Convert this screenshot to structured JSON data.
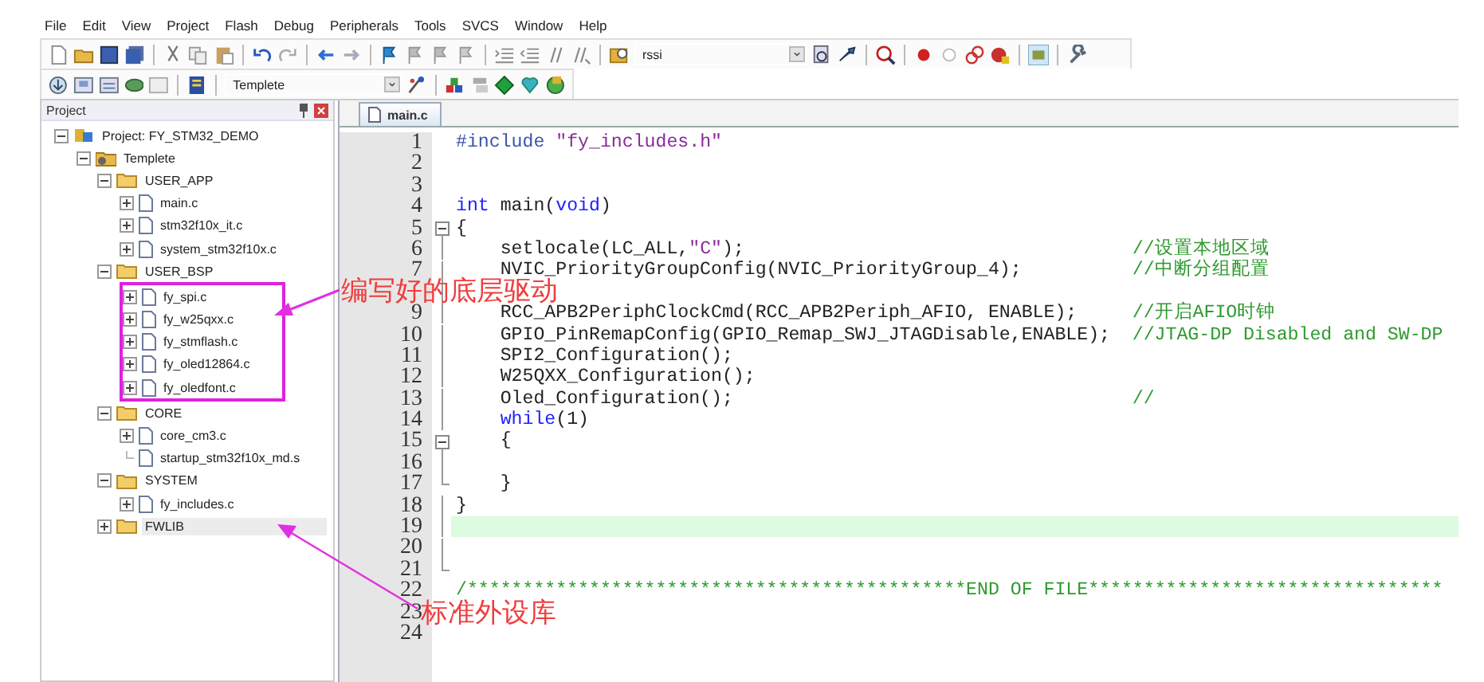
{
  "menu": [
    "File",
    "Edit",
    "View",
    "Project",
    "Flash",
    "Debug",
    "Peripherals",
    "Tools",
    "SVCS",
    "Window",
    "Help"
  ],
  "file_toolbar": {
    "find_text": "rssi"
  },
  "build_toolbar": {
    "target": "Templete"
  },
  "project_panel": {
    "title": "Project",
    "tree": [
      {
        "label": "Project: FY_STM32_DEMO",
        "kind": "project",
        "expanded": true,
        "selected": false,
        "children": [
          {
            "label": "Templete",
            "kind": "target",
            "expanded": true,
            "selected": false,
            "children": [
              {
                "label": "USER_APP",
                "kind": "group",
                "expanded": true,
                "selected": false,
                "children": [
                  {
                    "label": "main.c",
                    "kind": "file",
                    "expandable": true,
                    "selected": false
                  },
                  {
                    "label": "stm32f10x_it.c",
                    "kind": "file",
                    "expandable": true,
                    "selected": false
                  },
                  {
                    "label": "system_stm32f10x.c",
                    "kind": "file",
                    "expandable": true,
                    "selected": false
                  }
                ]
              },
              {
                "label": "USER_BSP",
                "kind": "group",
                "expanded": true,
                "selected": false,
                "boxed": true,
                "children": [
                  {
                    "label": "fy_spi.c",
                    "kind": "file",
                    "expandable": true,
                    "selected": false
                  },
                  {
                    "label": "fy_w25qxx.c",
                    "kind": "file",
                    "expandable": true,
                    "selected": false
                  },
                  {
                    "label": "fy_stmflash.c",
                    "kind": "file",
                    "expandable": true,
                    "selected": false
                  },
                  {
                    "label": "fy_oled12864.c",
                    "kind": "file",
                    "expandable": true,
                    "selected": false
                  },
                  {
                    "label": "fy_oledfont.c",
                    "kind": "file",
                    "expandable": true,
                    "selected": false
                  }
                ]
              },
              {
                "label": "CORE",
                "kind": "group",
                "expanded": true,
                "selected": false,
                "children": [
                  {
                    "label": "core_cm3.c",
                    "kind": "file",
                    "expandable": true,
                    "selected": false
                  },
                  {
                    "label": "startup_stm32f10x_md.s",
                    "kind": "file",
                    "expandable": false,
                    "selected": false
                  }
                ]
              },
              {
                "label": "SYSTEM",
                "kind": "group",
                "expanded": true,
                "selected": false,
                "children": [
                  {
                    "label": "fy_includes.c",
                    "kind": "file",
                    "expandable": true,
                    "selected": false
                  }
                ]
              },
              {
                "label": "FWLIB",
                "kind": "group",
                "expanded": false,
                "selected": true
              }
            ]
          }
        ]
      }
    ]
  },
  "editor": {
    "tabs": [
      {
        "label": "main.c",
        "selected": true
      }
    ],
    "lines": [
      {
        "number": "1",
        "kind": "plain",
        "code": [
          {
            "text": "#include",
            "kind": "preproc"
          },
          {
            "text": " \"fy_includes.h\"",
            "kind": "string"
          }
        ],
        "current": false
      },
      {
        "number": "2",
        "kind": "plain",
        "current": false
      },
      {
        "number": "3",
        "kind": "plain",
        "current": false
      },
      {
        "number": "4",
        "kind": "plain",
        "code": [
          {
            "text": "int",
            "kind": "keyword"
          },
          {
            "text": " main(",
            "kind": "plain"
          },
          {
            "text": "void",
            "kind": "keyword"
          },
          {
            "text": ")",
            "kind": "plain"
          }
        ],
        "current": false
      },
      {
        "number": "5",
        "kind": "fold_start",
        "code": [
          {
            "text": "{",
            "kind": "plain"
          }
        ],
        "current": false
      },
      {
        "number": "6",
        "kind": "fold_inside",
        "code": [
          {
            "text": "    setlocale(LC_ALL,",
            "kind": "plain"
          },
          {
            "text": "\"C\"",
            "kind": "string"
          },
          {
            "text": ");",
            "kind": "plain"
          }
        ],
        "comment": "//设置本地区域",
        "current": false
      },
      {
        "number": "7",
        "kind": "fold_inside",
        "code": [
          {
            "text": "    NVIC_PriorityGroupConfig(NVIC_PriorityGroup_4);",
            "kind": "plain"
          }
        ],
        "comment": "//中断分组配置",
        "current": false
      },
      {
        "kind": "fold_inside",
        "current": false
      },
      {
        "number": "9",
        "kind": "fold_inside",
        "code": [
          {
            "text": "    RCC_APB2PeriphClockCmd(RCC_APB2Periph_AFIO, ENABLE);",
            "kind": "plain"
          }
        ],
        "comment": "//开启AFIO时钟",
        "current": false
      },
      {
        "number": "10",
        "kind": "fold_inside",
        "code": [
          {
            "text": "    GPIO_PinRemapConfig(GPIO_Remap_SWJ_JTAGDisable,ENABLE);",
            "kind": "plain"
          }
        ],
        "comment": "//JTAG-DP Disabled and SW-DP",
        "current": false
      },
      {
        "number": "11",
        "kind": "fold_inside",
        "code": [
          {
            "text": "    SPI2_Configuration();",
            "kind": "plain"
          }
        ],
        "current": false
      },
      {
        "number": "12",
        "kind": "fold_inside",
        "code": [
          {
            "text": "    W25QXX_Configuration();",
            "kind": "plain"
          }
        ],
        "current": false
      },
      {
        "number": "13",
        "kind": "fold_inside",
        "code": [
          {
            "text": "    Oled_Configuration();",
            "kind": "plain"
          }
        ],
        "comment": "//",
        "current": false
      },
      {
        "number": "14",
        "kind": "fold_inside",
        "code": [
          {
            "text": "    while",
            "kind": "keyword"
          },
          {
            "text": "(1)",
            "kind": "plain"
          }
        ],
        "current": false
      },
      {
        "number": "15",
        "kind": "fold_start",
        "code": [
          {
            "text": "    {",
            "kind": "plain"
          }
        ],
        "current": false
      },
      {
        "number": "16",
        "kind": "fold_inside",
        "current": false
      },
      {
        "number": "17",
        "kind": "fold_end",
        "code": [
          {
            "text": "    }",
            "kind": "plain"
          }
        ],
        "current": false
      },
      {
        "number": "18",
        "kind": "fold_inside",
        "code": [
          {
            "text": "}",
            "kind": "plain"
          }
        ],
        "current": false
      },
      {
        "number": "19",
        "kind": "fold_inside",
        "current": true
      },
      {
        "number": "20",
        "kind": "fold_inside",
        "current": false
      },
      {
        "number": "21",
        "kind": "fold_end",
        "current": false
      },
      {
        "number": "22",
        "kind": "plain",
        "comment": "/*********************************************END OF FILE********************************",
        "current": false
      },
      {
        "number": "23",
        "kind": "plain",
        "current": false
      },
      {
        "number": "24",
        "kind": "plain",
        "current": false
      }
    ]
  },
  "annotations": [
    {
      "text": "编写好的底层驱动"
    },
    {
      "text": "标准外设库"
    }
  ]
}
